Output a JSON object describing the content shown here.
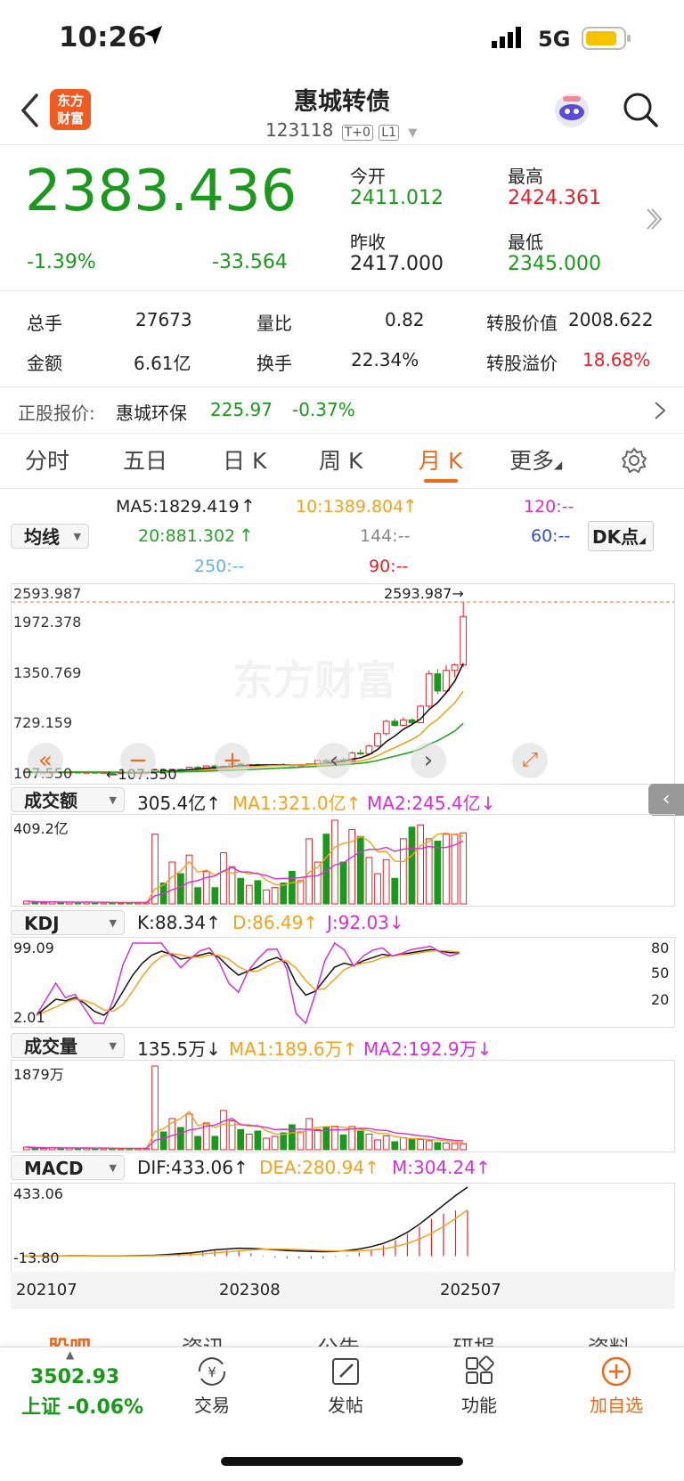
{
  "status_bar": {
    "time": "10:26",
    "network": "5G"
  },
  "header": {
    "title": "惠城转债",
    "code": "123118",
    "badge1": "T+0",
    "badge2": "L1",
    "logo_text": "东方财富"
  },
  "quote": {
    "price": "2383.436",
    "change_pct": "-1.39%",
    "change": "-33.564",
    "open_label": "今开",
    "open": "2411.012",
    "high_label": "最高",
    "high": "2424.361",
    "prev_close_label": "昨收",
    "prev_close": "2417.000",
    "low_label": "最低",
    "low": "2345.000"
  },
  "stats": {
    "vol_label": "总手",
    "vol": "27673",
    "ratio_label": "量比",
    "ratio": "0.82",
    "conv_value_label": "转股价值",
    "conv_value": "2008.622",
    "amount_label": "金额",
    "amount": "6.61亿",
    "turnover_label": "换手",
    "turnover": "22.34%",
    "premium_label": "转股溢价",
    "premium": "18.68%"
  },
  "underlying": {
    "label": "正股报价:",
    "name": "惠城环保",
    "price": "225.97",
    "change": "-0.37%"
  },
  "tabs": [
    "分时",
    "五日",
    "日 K",
    "周 K",
    "月 K",
    "更多"
  ],
  "ma_legend": {
    "selector": "均线",
    "ma5": "MA5:1829.419",
    "ma10": "10:1389.804",
    "ma120": "120:--",
    "ma20": "20:881.302",
    "ma144": "144:--",
    "ma60": "60:--",
    "ma250": "250:--",
    "ma90": "90:--",
    "dk_button": "DK点"
  },
  "main_chart": {
    "y_ticks": [
      "2593.987",
      "1972.378",
      "1350.769",
      "729.159",
      "107.550"
    ],
    "max_label": "2593.987",
    "min_label": "107.550",
    "watermark": "东方财富"
  },
  "amount_panel": {
    "selector": "成交额",
    "value": "305.4亿",
    "ma1": "MA1:321.0亿",
    "ma2": "MA2:245.4亿",
    "max": "409.2亿"
  },
  "kdj_panel": {
    "selector": "KDJ",
    "k": "K:88.34",
    "d": "D:86.49",
    "j": "J:92.03",
    "max": "99.09",
    "min": "2.01",
    "levels": [
      "80",
      "50",
      "20"
    ]
  },
  "volume_panel": {
    "selector": "成交量",
    "value": "135.5万",
    "ma1": "MA1:189.6万",
    "ma2": "MA2:192.9万",
    "max": "1879万"
  },
  "macd_panel": {
    "selector": "MACD",
    "dif": "DIF:433.06",
    "dea": "DEA:280.94",
    "m": "M:304.24",
    "max": "433.06",
    "min": "-13.80"
  },
  "x_axis": [
    "202107",
    "202308",
    "202507"
  ],
  "bottom_tabs": [
    "股吧",
    "资讯",
    "公告",
    "研报",
    "资料"
  ],
  "bottom_bar": {
    "index_value": "3502.93",
    "index_label": "上证 -0.06%",
    "trade": "交易",
    "post": "发帖",
    "function": "功能",
    "add": "加自选"
  },
  "colors": {
    "up": "#e8202a",
    "down": "#1a9a1a",
    "accent": "#ee6a1b",
    "ma10": "#f2a31b",
    "ma20": "#23a623",
    "ma120": "#d62fd6",
    "ma60": "#2b4fd6",
    "ma250": "#5ab4f0"
  },
  "chart_data": {
    "type": "candlestick",
    "x_axis_labels": [
      "202107",
      "202308",
      "202507"
    ],
    "y_ticks": [
      2593.987,
      1972.378,
      1350.769,
      729.159,
      107.55
    ],
    "ylim": [
      107.55,
      2593.987
    ],
    "ohlc": [
      [
        112,
        130,
        108,
        125
      ],
      [
        125,
        128,
        115,
        118
      ],
      [
        118,
        122,
        112,
        120
      ],
      [
        120,
        126,
        116,
        122
      ],
      [
        122,
        125,
        117,
        119
      ],
      [
        119,
        124,
        115,
        121
      ],
      [
        121,
        123,
        114,
        116
      ],
      [
        116,
        120,
        110,
        118
      ],
      [
        118,
        121,
        113,
        115
      ],
      [
        115,
        119,
        109,
        117
      ],
      [
        117,
        120,
        112,
        114
      ],
      [
        114,
        118,
        108,
        116
      ],
      [
        116,
        119,
        110,
        113
      ],
      [
        113,
        117,
        108,
        115
      ],
      [
        115,
        120,
        110,
        118
      ],
      [
        118,
        160,
        115,
        150
      ],
      [
        150,
        175,
        140,
        145
      ],
      [
        145,
        170,
        138,
        160
      ],
      [
        160,
        168,
        130,
        140
      ],
      [
        140,
        200,
        135,
        190
      ],
      [
        190,
        210,
        170,
        180
      ],
      [
        180,
        220,
        175,
        210
      ],
      [
        210,
        230,
        190,
        195
      ],
      [
        195,
        215,
        180,
        205
      ],
      [
        205,
        250,
        195,
        240
      ],
      [
        240,
        260,
        210,
        220
      ],
      [
        220,
        240,
        200,
        230
      ],
      [
        230,
        245,
        205,
        215
      ],
      [
        215,
        235,
        200,
        225
      ],
      [
        225,
        240,
        210,
        230
      ],
      [
        230,
        250,
        215,
        225
      ],
      [
        225,
        235,
        205,
        215
      ],
      [
        215,
        235,
        205,
        225
      ],
      [
        225,
        245,
        215,
        240
      ],
      [
        240,
        300,
        230,
        290
      ],
      [
        290,
        310,
        250,
        270
      ],
      [
        270,
        320,
        260,
        300
      ],
      [
        300,
        330,
        270,
        285
      ],
      [
        285,
        420,
        280,
        400
      ],
      [
        400,
        450,
        370,
        385
      ],
      [
        385,
        520,
        380,
        500
      ],
      [
        500,
        700,
        480,
        680
      ],
      [
        680,
        880,
        650,
        860
      ],
      [
        860,
        900,
        780,
        800
      ],
      [
        800,
        920,
        790,
        880
      ],
      [
        880,
        900,
        820,
        840
      ],
      [
        840,
        1100,
        830,
        1080
      ],
      [
        1080,
        1600,
        1050,
        1550
      ],
      [
        1550,
        1620,
        1250,
        1300
      ],
      [
        1300,
        1680,
        1280,
        1600
      ],
      [
        1600,
        1700,
        1500,
        1680
      ],
      [
        1680,
        2593.987,
        1650,
        2383.436
      ]
    ],
    "amount": [
      12,
      8,
      5,
      10,
      6,
      7,
      5,
      8,
      6,
      5,
      6,
      4,
      5,
      6,
      7,
      300,
      90,
      180,
      130,
      210,
      70,
      140,
      70,
      220,
      160,
      110,
      80,
      100,
      60,
      70,
      90,
      140,
      100,
      280,
      180,
      300,
      360,
      180,
      320,
      290,
      200,
      130,
      190,
      110,
      280,
      330,
      340,
      280,
      270,
      300,
      300,
      305.4
    ],
    "kdj_k": [
      10,
      20,
      30,
      28,
      32,
      25,
      15,
      10,
      20,
      40,
      60,
      75,
      85,
      90,
      86,
      80,
      82,
      85,
      88,
      82,
      70,
      60,
      65,
      70,
      78,
      82,
      75,
      50,
      35,
      40,
      55,
      70,
      75,
      72,
      78,
      82,
      86,
      84,
      86,
      88,
      90,
      92,
      90,
      88,
      88.34
    ],
    "volume": [
      60,
      40,
      30,
      45,
      35,
      40,
      30,
      35,
      30,
      28,
      30,
      25,
      27,
      30,
      32,
      1879,
      400,
      700,
      500,
      800,
      300,
      600,
      300,
      880,
      650,
      450,
      350,
      420,
      260,
      300,
      380,
      560,
      400,
      700,
      450,
      500,
      530,
      330,
      520,
      420,
      350,
      220,
      310,
      180,
      270,
      250,
      230,
      200,
      160,
      150,
      140,
      135.5
    ],
    "macd_dif": [
      0,
      1,
      2,
      2,
      3,
      3,
      2,
      2,
      2,
      3,
      4,
      6,
      10,
      15,
      20,
      30,
      40,
      45,
      50,
      48,
      45,
      40,
      35,
      32,
      30,
      28,
      30,
      35,
      45,
      60,
      80,
      110,
      150,
      200,
      260,
      320,
      380,
      433.06
    ]
  }
}
